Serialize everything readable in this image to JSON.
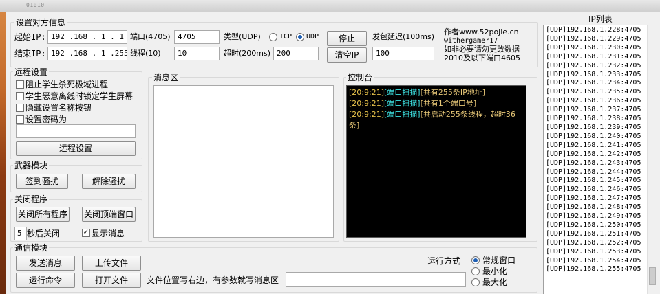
{
  "window": {
    "title": "01010"
  },
  "target": {
    "group_label": "设置对方信息",
    "start_ip_label": "起始IP:",
    "start_ip_value": "192 .168 . 1  . 1",
    "end_ip_label": "结束IP:",
    "end_ip_value": "192 .168 . 1  .255",
    "port_label": "端口(4705)",
    "port_value": "4705",
    "threads_label": "线程(10)",
    "threads_value": "10",
    "type_label": "类型(UDP)",
    "tcp_label": "TCP",
    "udp_label": "UDP",
    "timeout_label": "超时(200ms)",
    "timeout_value": "200",
    "stop_button": "停止",
    "clear_ip_button": "清空IP",
    "delay_label": "发包延迟(100ms)",
    "delay_value": "100",
    "author_line1": "作者www.52pojie.cn",
    "author_line2": "withergamer17",
    "author_line3": "如非必要请勿更改数据",
    "author_line4": "2010及以下端口4605"
  },
  "remote": {
    "group_label": "远程设置",
    "opt1": "阻止学生杀死极域进程",
    "opt2": "学生恶意离线时锁定学生屏幕",
    "opt3": "隐藏设置名称按钮",
    "opt4": "设置密码为",
    "password_value": "",
    "button": "远程设置"
  },
  "weapon": {
    "group_label": "武器模块",
    "sign_button": "签到骚扰",
    "release_button": "解除骚扰"
  },
  "close": {
    "group_label": "关闭程序",
    "close_all_button": "关闭所有程序",
    "close_top_button": "关闭顶端窗口",
    "delay_value": "5",
    "delay_suffix": "秒后关闭",
    "show_msg_label": "显示消息"
  },
  "message": {
    "group_label": "消息区"
  },
  "console": {
    "group_label": "控制台",
    "lines": [
      {
        "time": "[20:9:21]",
        "tag": "[端口扫描]",
        "text": "[共有255条IP地址]"
      },
      {
        "time": "[20:9:21]",
        "tag": "[端口扫描]",
        "text": "[共有1个端口号]"
      },
      {
        "time": "[20:9:21]",
        "tag": "[端口扫描]",
        "text": "[共启动255条线程，超时36条]"
      }
    ]
  },
  "comm": {
    "group_label": "通信模块",
    "send_msg_button": "发送消息",
    "upload_button": "上传文件",
    "run_cmd_button": "运行命令",
    "open_file_button": "打开文件",
    "hint": "文件位置写右边，有参数就写消息区",
    "path_value": "",
    "run_mode_label": "运行方式",
    "mode_normal": "常规窗口",
    "mode_min": "最小化",
    "mode_max": "最大化"
  },
  "iplist": {
    "title": "IP列表",
    "items": [
      "[UDP]192.168.1.228:4705",
      "[UDP]192.168.1.229:4705",
      "[UDP]192.168.1.230:4705",
      "[UDP]192.168.1.231:4705",
      "[UDP]192.168.1.232:4705",
      "[UDP]192.168.1.233:4705",
      "[UDP]192.168.1.234:4705",
      "[UDP]192.168.1.235:4705",
      "[UDP]192.168.1.236:4705",
      "[UDP]192.168.1.237:4705",
      "[UDP]192.168.1.238:4705",
      "[UDP]192.168.1.239:4705",
      "[UDP]192.168.1.240:4705",
      "[UDP]192.168.1.241:4705",
      "[UDP]192.168.1.242:4705",
      "[UDP]192.168.1.243:4705",
      "[UDP]192.168.1.244:4705",
      "[UDP]192.168.1.245:4705",
      "[UDP]192.168.1.246:4705",
      "[UDP]192.168.1.247:4705",
      "[UDP]192.168.1.248:4705",
      "[UDP]192.168.1.249:4705",
      "[UDP]192.168.1.250:4705",
      "[UDP]192.168.1.251:4705",
      "[UDP]192.168.1.252:4705",
      "[UDP]192.168.1.253:4705",
      "[UDP]192.168.1.254:4705",
      "[UDP]192.168.1.255:4705"
    ]
  }
}
